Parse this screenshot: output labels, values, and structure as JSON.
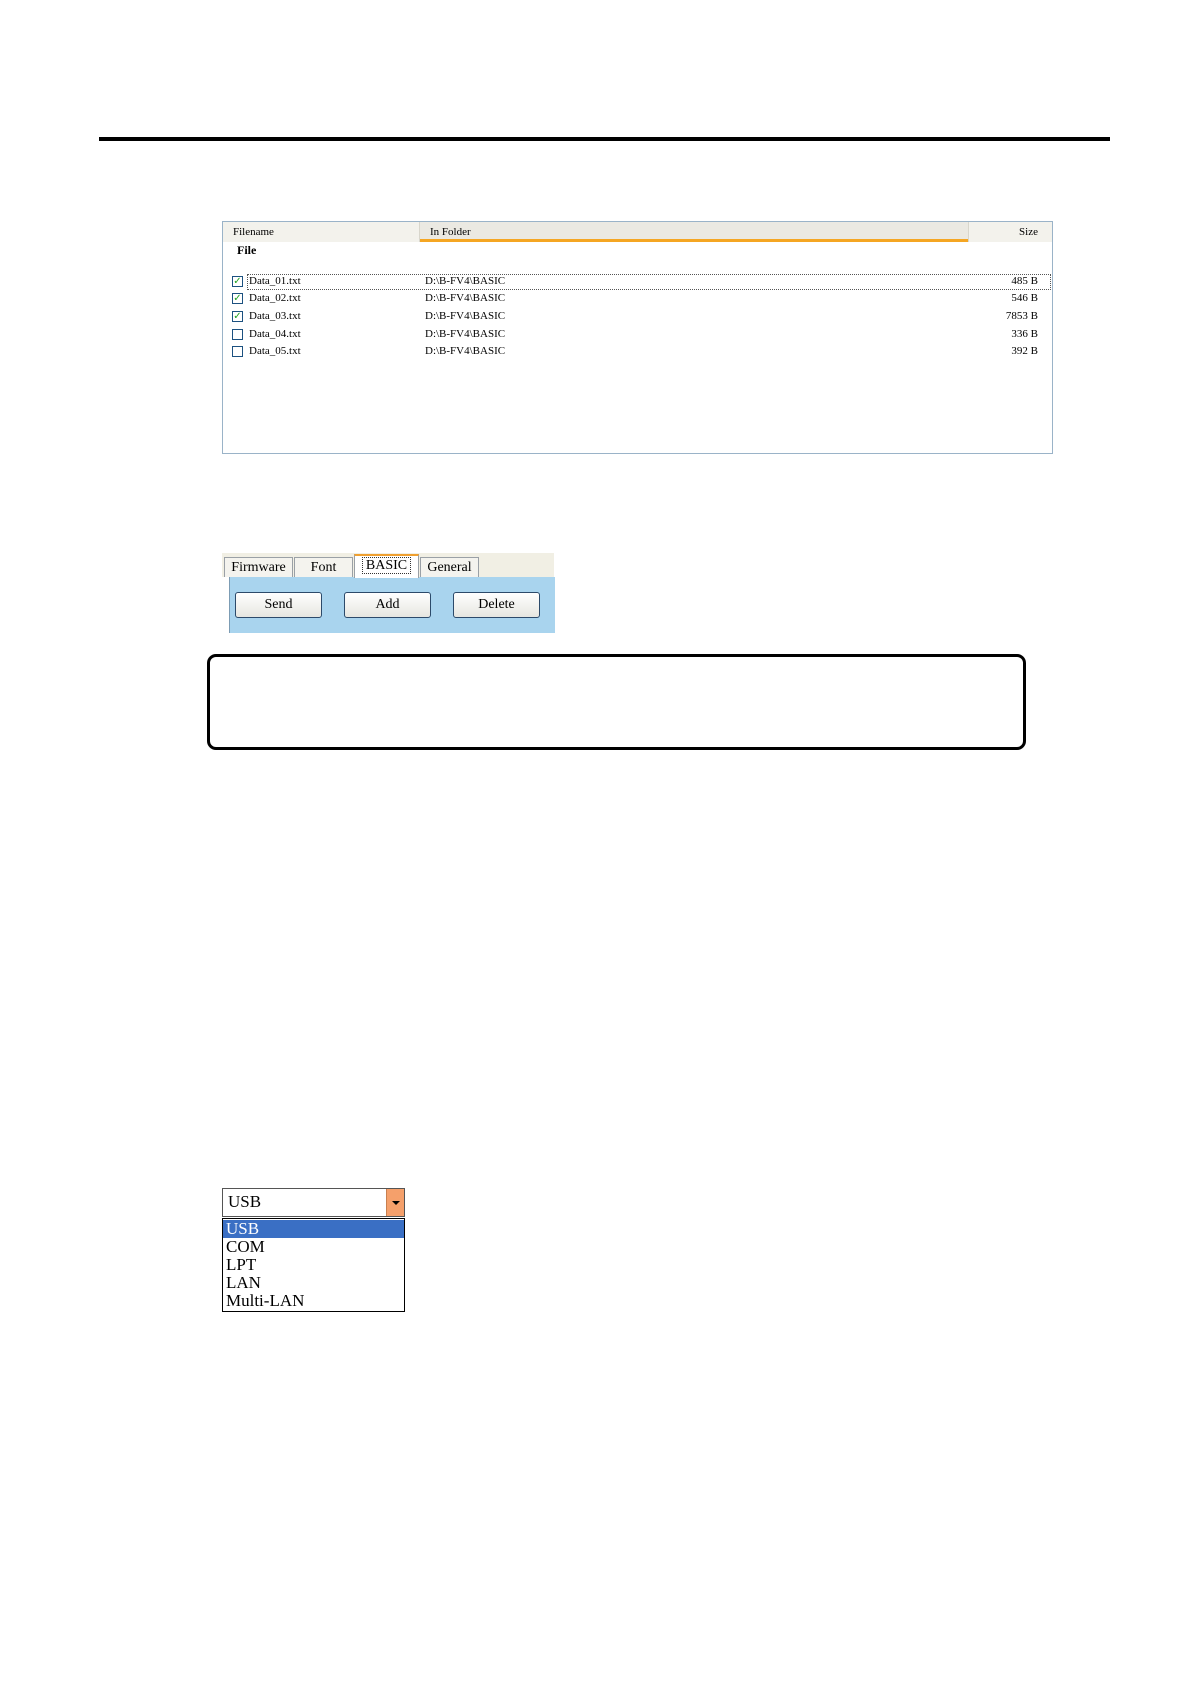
{
  "file_list": {
    "columns": {
      "filename": "Filename",
      "in_folder": "In Folder",
      "size": "Size"
    },
    "group_label": "File",
    "rows": [
      {
        "name": "Data_01.txt",
        "folder": "D:\\B-FV4\\BASIC",
        "size": "485 B",
        "checked": true
      },
      {
        "name": "Data_02.txt",
        "folder": "D:\\B-FV4\\BASIC",
        "size": "546 B",
        "checked": true
      },
      {
        "name": "Data_03.txt",
        "folder": "D:\\B-FV4\\BASIC",
        "size": "7853 B",
        "checked": true
      },
      {
        "name": "Data_04.txt",
        "folder": "D:\\B-FV4\\BASIC",
        "size": "336 B",
        "checked": false
      },
      {
        "name": "Data_05.txt",
        "folder": "D:\\B-FV4\\BASIC",
        "size": "392 B",
        "checked": false
      }
    ]
  },
  "tabs": {
    "items": [
      "Firmware",
      "Font",
      "BASIC",
      "General"
    ],
    "active": "BASIC",
    "buttons": {
      "send": "Send",
      "add": "Add",
      "delete": "Delete"
    }
  },
  "interface_combo": {
    "value": "USB",
    "options": [
      "USB",
      "COM",
      "LPT",
      "LAN",
      "Multi-LAN"
    ],
    "highlighted": "USB"
  },
  "colors": {
    "tab_panel": "#a9d4ee",
    "header_accent": "#f5a623",
    "selection": "#3a6fc4",
    "check_mark": "#21a121"
  }
}
